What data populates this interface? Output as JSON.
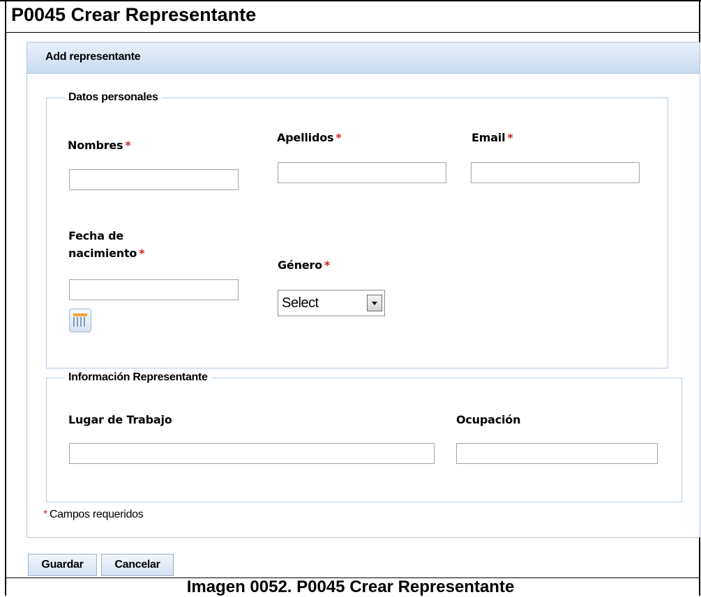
{
  "document": {
    "title": "P0045 Crear Representante",
    "caption": "Imagen 0052. P0045 Crear Representante"
  },
  "panel": {
    "header": "Add representante"
  },
  "personal": {
    "legend": "Datos personales",
    "nombres_label": "Nombres",
    "nombres_value": "",
    "apellidos_label": "Apellidos",
    "apellidos_value": "",
    "email_label": "Email",
    "email_value": "",
    "fecha_label_line1": "Fecha de",
    "fecha_label_line2": "nacimiento",
    "fecha_value": "",
    "genero_label": "Género",
    "genero_selected": "Select",
    "required_mark": "*"
  },
  "representante": {
    "legend": "Información Representante",
    "lugar_label": "Lugar de Trabajo",
    "lugar_value": "",
    "ocupacion_label": "Ocupación",
    "ocupacion_value": ""
  },
  "footer": {
    "required_mark": "*",
    "required_note": "Campos requeridos",
    "save_label": "Guardar",
    "cancel_label": "Cancelar"
  },
  "colors": {
    "required": "#d21f1f",
    "header_gradient_top": "#e9f1fb",
    "header_gradient_bottom": "#c9daf0",
    "fieldset_border": "#b6cde4"
  },
  "icons": {
    "calendar": "calendar-icon",
    "dropdown": "chevron-down-icon"
  }
}
